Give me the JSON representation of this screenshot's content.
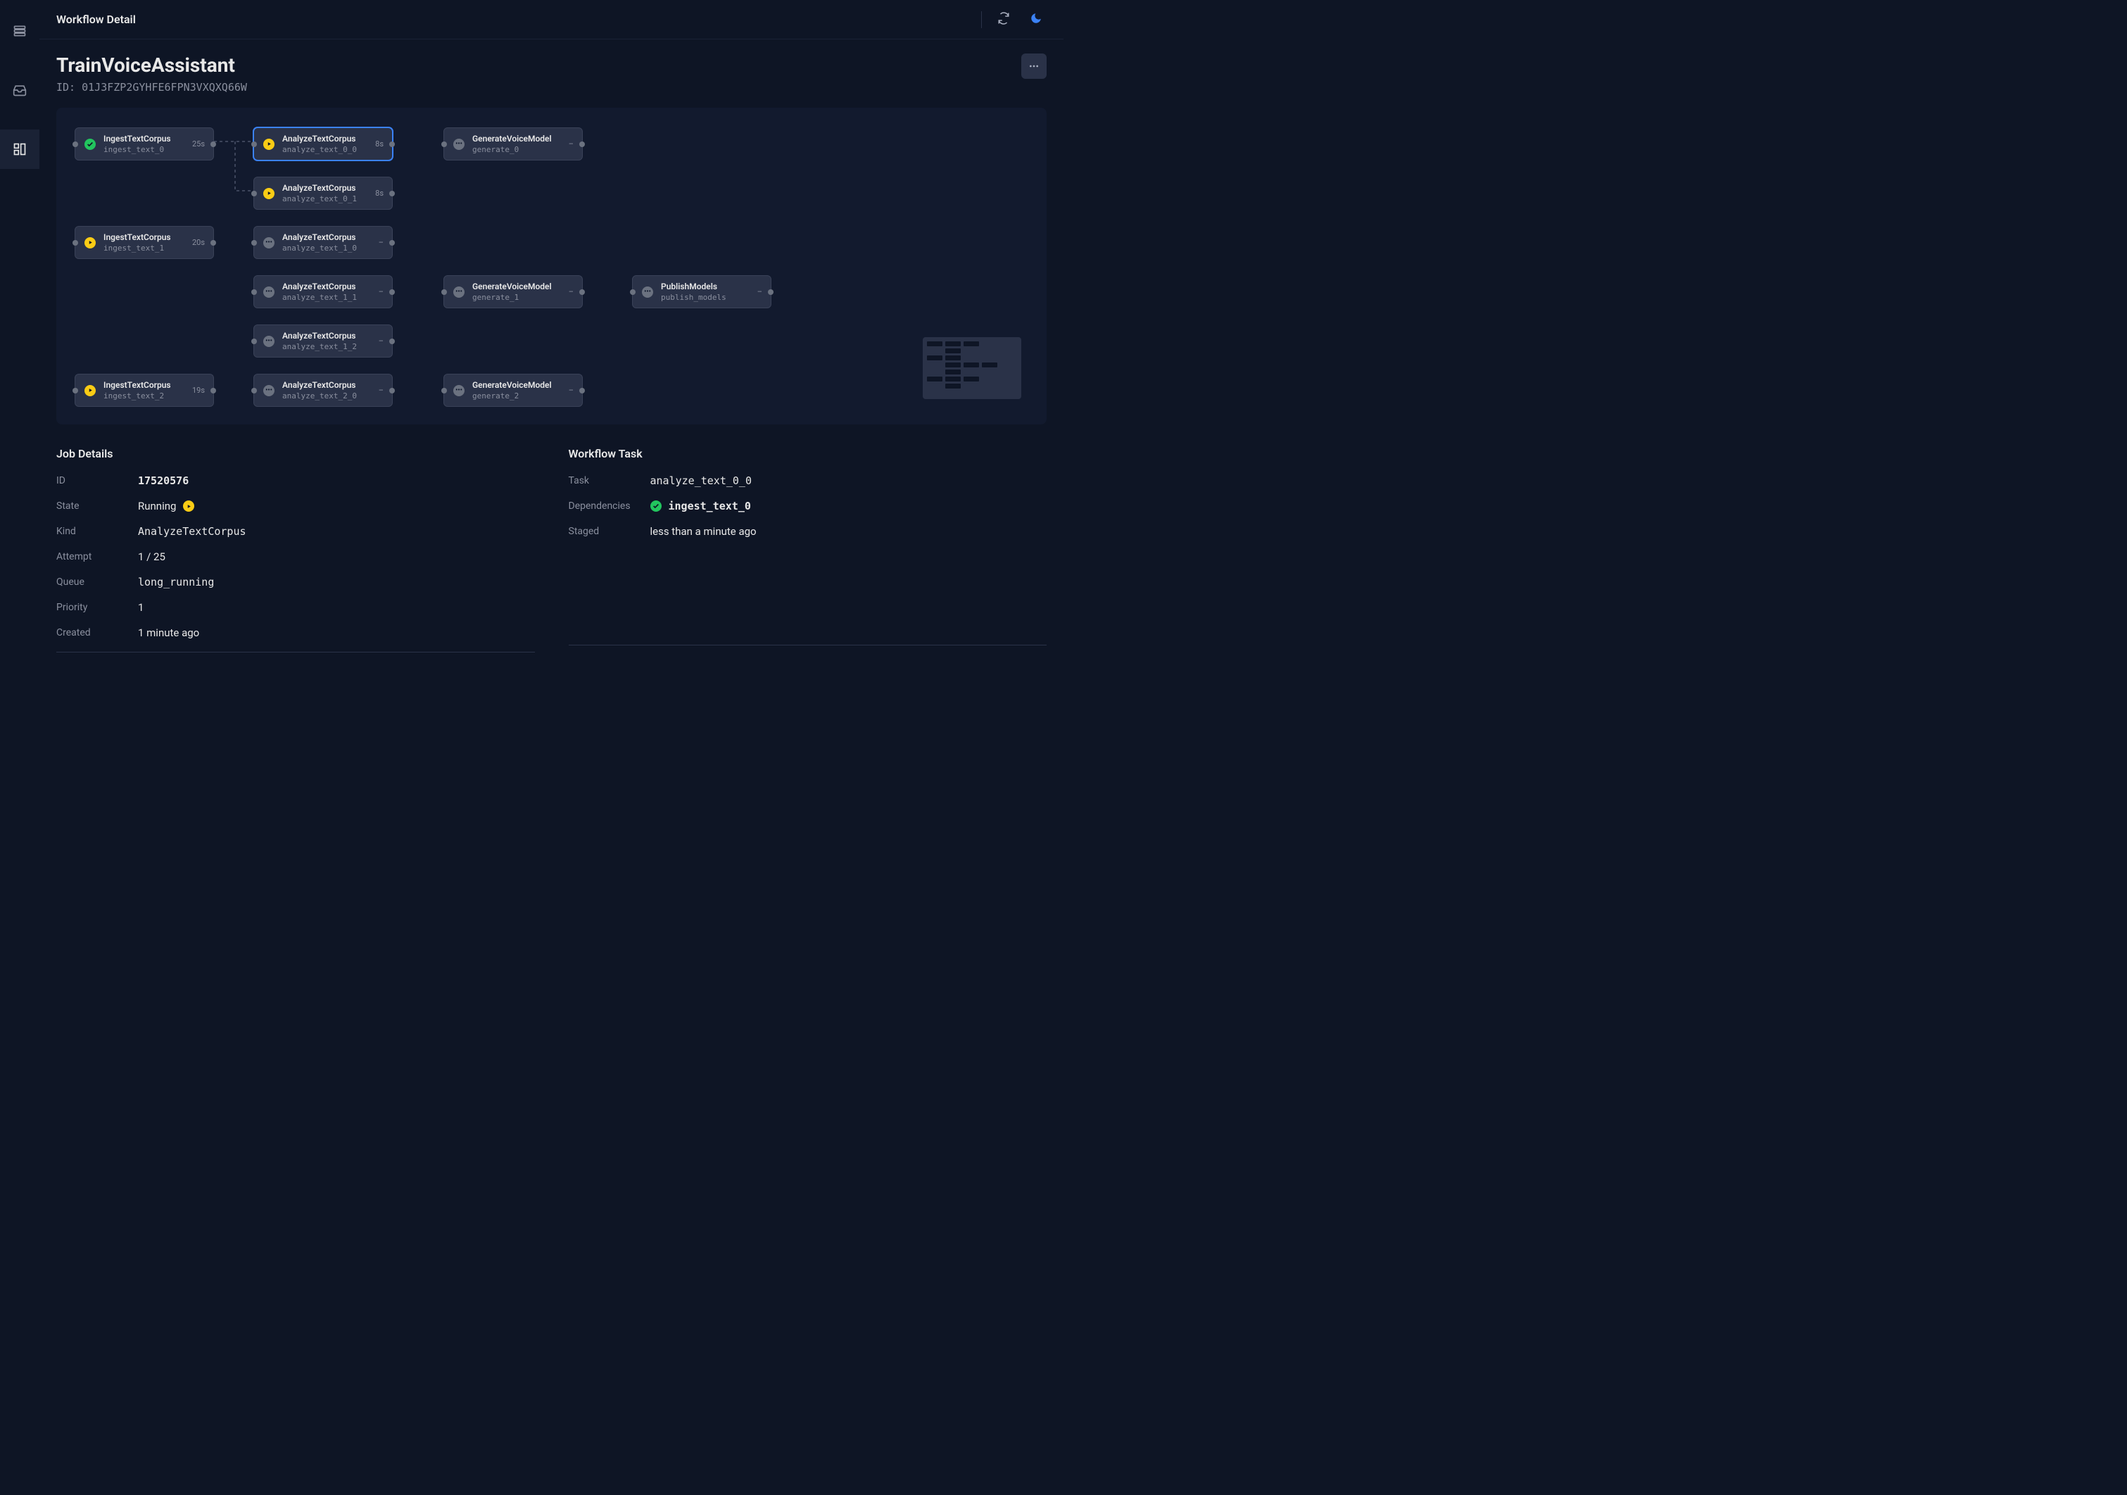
{
  "topbar": {
    "title": "Workflow Detail"
  },
  "workflow": {
    "name": "TrainVoiceAssistant",
    "id_label": "ID: 01J3FZP2GYHFE6FPN3VXQXQ66W"
  },
  "nodes": {
    "ingest0": {
      "name": "IngestTextCorpus",
      "id": "ingest_text_0",
      "time": "25s",
      "status": "done"
    },
    "ingest1": {
      "name": "IngestTextCorpus",
      "id": "ingest_text_1",
      "time": "20s",
      "status": "running"
    },
    "ingest2": {
      "name": "IngestTextCorpus",
      "id": "ingest_text_2",
      "time": "19s",
      "status": "running"
    },
    "analyze00": {
      "name": "AnalyzeTextCorpus",
      "id": "analyze_text_0_0",
      "time": "8s",
      "status": "running",
      "selected": true
    },
    "analyze01": {
      "name": "AnalyzeTextCorpus",
      "id": "analyze_text_0_1",
      "time": "8s",
      "status": "running"
    },
    "analyze10": {
      "name": "AnalyzeTextCorpus",
      "id": "analyze_text_1_0",
      "time": "–",
      "status": "pending"
    },
    "analyze11": {
      "name": "AnalyzeTextCorpus",
      "id": "analyze_text_1_1",
      "time": "–",
      "status": "pending"
    },
    "analyze12": {
      "name": "AnalyzeTextCorpus",
      "id": "analyze_text_1_2",
      "time": "–",
      "status": "pending"
    },
    "analyze20": {
      "name": "AnalyzeTextCorpus",
      "id": "analyze_text_2_0",
      "time": "–",
      "status": "pending"
    },
    "gen0": {
      "name": "GenerateVoiceModel",
      "id": "generate_0",
      "time": "–",
      "status": "pending"
    },
    "gen1": {
      "name": "GenerateVoiceModel",
      "id": "generate_1",
      "time": "–",
      "status": "pending"
    },
    "gen2": {
      "name": "GenerateVoiceModel",
      "id": "generate_2",
      "time": "–",
      "status": "pending"
    },
    "publish": {
      "name": "PublishModels",
      "id": "publish_models",
      "time": "–",
      "status": "pending"
    }
  },
  "job_details": {
    "title": "Job Details",
    "rows": {
      "id": {
        "label": "ID",
        "value": "17520576"
      },
      "state": {
        "label": "State",
        "value": "Running"
      },
      "kind": {
        "label": "Kind",
        "value": "AnalyzeTextCorpus"
      },
      "attempt": {
        "label": "Attempt",
        "value": "1 / 25"
      },
      "queue": {
        "label": "Queue",
        "value": "long_running"
      },
      "priority": {
        "label": "Priority",
        "value": "1"
      },
      "created": {
        "label": "Created",
        "value": "1 minute ago"
      }
    }
  },
  "workflow_task": {
    "title": "Workflow Task",
    "rows": {
      "task": {
        "label": "Task",
        "value": "analyze_text_0_0"
      },
      "deps": {
        "label": "Dependencies",
        "value": "ingest_text_0"
      },
      "staged": {
        "label": "Staged",
        "value": "less than a minute ago"
      }
    }
  }
}
